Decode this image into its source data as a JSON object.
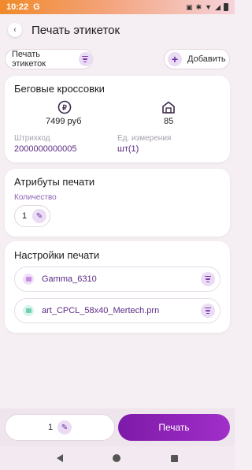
{
  "status_bar": {
    "time": "10:22",
    "g_label": "G"
  },
  "header": {
    "title": "Печать этикеток"
  },
  "toolbar": {
    "filter_label": "Печать этикеток",
    "add_label": "Добавить"
  },
  "product": {
    "name": "Беговые кроссовки",
    "price": "7499 руб",
    "stock": "85",
    "barcode_label": "Штрихкод",
    "barcode_value": "2000000000005",
    "unit_label": "Ед. измерения",
    "unit_value": "шт(1)"
  },
  "print_attributes": {
    "title": "Атрибуты печати",
    "quantity_label": "Количество",
    "quantity_value": "1"
  },
  "print_settings": {
    "title": "Настройки печати",
    "items": [
      {
        "name": "Gamma_6310",
        "icon": "printer-icon",
        "color": "#c78de0"
      },
      {
        "name": "art_CPCL_58x40_Mertech.prn",
        "icon": "template-icon",
        "color": "#6fd0b5"
      }
    ]
  },
  "bottom": {
    "count": "1",
    "print_label": "Печать"
  },
  "colors": {
    "accent": "#7d1aa8",
    "accent_light": "#eadcf4",
    "background": "#f5eef2"
  }
}
